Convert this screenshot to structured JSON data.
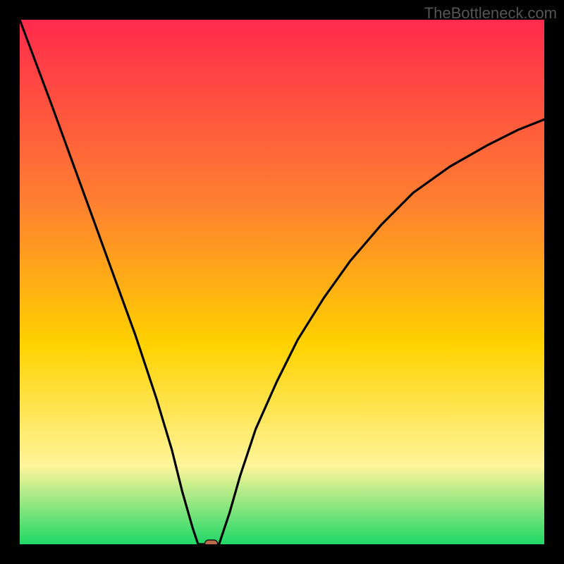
{
  "watermark": "TheBottleneck.com",
  "colors": {
    "frame": "#000000",
    "gradient_top": "#ff2a4d",
    "gradient_mid1": "#ff8030",
    "gradient_mid2": "#ffd200",
    "gradient_mid3": "#fff59a",
    "gradient_bottom": "#20d867",
    "curve": "#000000",
    "marker_fill": "#b86a4a",
    "marker_stroke": "#000000"
  },
  "chart_data": {
    "type": "line",
    "title": "",
    "xlabel": "",
    "ylabel": "",
    "xlim": [
      0,
      100
    ],
    "ylim": [
      0,
      100
    ],
    "vertex_x": 35,
    "marker": {
      "x": 36.5,
      "y": 0
    },
    "curve_points_left": [
      {
        "x": 0,
        "y": 100
      },
      {
        "x": 3,
        "y": 92
      },
      {
        "x": 6,
        "y": 84
      },
      {
        "x": 10,
        "y": 73
      },
      {
        "x": 14,
        "y": 62
      },
      {
        "x": 18,
        "y": 51
      },
      {
        "x": 22,
        "y": 40
      },
      {
        "x": 26,
        "y": 28
      },
      {
        "x": 29,
        "y": 18
      },
      {
        "x": 31,
        "y": 10
      },
      {
        "x": 33,
        "y": 3
      },
      {
        "x": 34,
        "y": 0
      }
    ],
    "plateau": [
      {
        "x": 34,
        "y": 0
      },
      {
        "x": 38,
        "y": 0
      }
    ],
    "curve_points_right": [
      {
        "x": 38,
        "y": 0
      },
      {
        "x": 40,
        "y": 6
      },
      {
        "x": 42,
        "y": 13
      },
      {
        "x": 45,
        "y": 22
      },
      {
        "x": 49,
        "y": 31
      },
      {
        "x": 53,
        "y": 39
      },
      {
        "x": 58,
        "y": 47
      },
      {
        "x": 63,
        "y": 54
      },
      {
        "x": 69,
        "y": 61
      },
      {
        "x": 75,
        "y": 67
      },
      {
        "x": 82,
        "y": 72
      },
      {
        "x": 89,
        "y": 76
      },
      {
        "x": 95,
        "y": 79
      },
      {
        "x": 100,
        "y": 81
      }
    ]
  }
}
